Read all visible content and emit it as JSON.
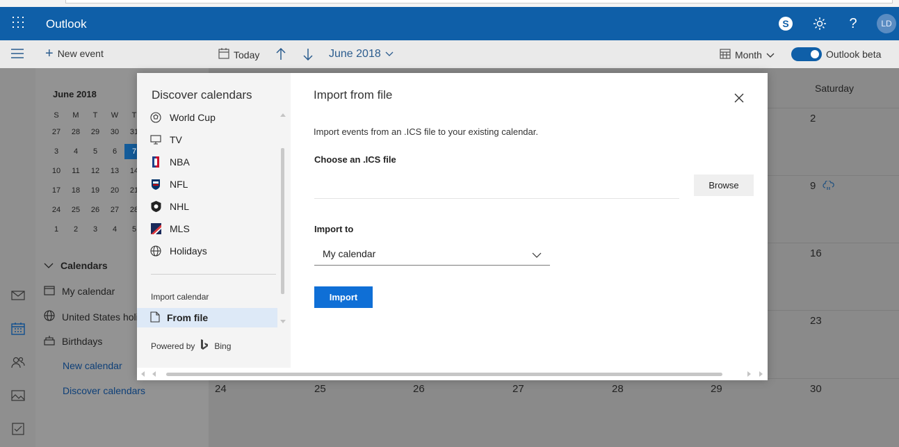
{
  "header": {
    "app_title": "Outlook",
    "avatar_initials": "LD",
    "icons": [
      "waffle-icon",
      "skype-icon",
      "gear-icon",
      "help-icon"
    ]
  },
  "commandbar": {
    "new_event": "New event",
    "today": "Today",
    "month_label": "June 2018",
    "view": "Month",
    "beta_toggle": "Outlook beta",
    "beta_on": true
  },
  "minical": {
    "title": "June 2018",
    "weekdays": [
      "S",
      "M",
      "T",
      "W",
      "T"
    ],
    "rows": [
      [
        "27",
        "28",
        "29",
        "30",
        "31"
      ],
      [
        "3",
        "4",
        "5",
        "6",
        "7"
      ],
      [
        "10",
        "11",
        "12",
        "13",
        "14"
      ],
      [
        "17",
        "18",
        "19",
        "20",
        "21"
      ],
      [
        "24",
        "25",
        "26",
        "27",
        "28"
      ],
      [
        "1",
        "2",
        "3",
        "4",
        "5"
      ]
    ],
    "selected": "7"
  },
  "leftpane": {
    "calendars_header": "Calendars",
    "items": [
      "My calendar",
      "United States holi",
      "Birthdays"
    ],
    "new_calendar": "New calendar",
    "discover_calendars": "Discover calendars"
  },
  "calendar": {
    "saturday_header": "Saturday",
    "saturday_dates": [
      "2",
      "9",
      "16",
      "23",
      "30"
    ],
    "bottom_row": [
      "24",
      "25",
      "26",
      "27",
      "28",
      "29"
    ]
  },
  "modal": {
    "left_title": "Discover calendars",
    "items": [
      {
        "label": "World Cup",
        "icon": "soccer-ball-icon"
      },
      {
        "label": "TV",
        "icon": "tv-icon"
      },
      {
        "label": "NBA",
        "icon": "nba-logo-icon"
      },
      {
        "label": "NFL",
        "icon": "nfl-logo-icon"
      },
      {
        "label": "NHL",
        "icon": "nhl-logo-icon"
      },
      {
        "label": "MLS",
        "icon": "mls-logo-icon"
      },
      {
        "label": "Holidays",
        "icon": "globe-icon"
      }
    ],
    "import_calendar_label": "Import calendar",
    "from_file": "From file",
    "powered_by": "Powered by",
    "bing": "Bing",
    "right_title": "Import from file",
    "description": "Import events from an .ICS file to your existing calendar.",
    "choose_label": "Choose an .ICS file",
    "browse": "Browse",
    "import_to_label": "Import to",
    "import_to_value": "My calendar",
    "import_button": "Import"
  }
}
